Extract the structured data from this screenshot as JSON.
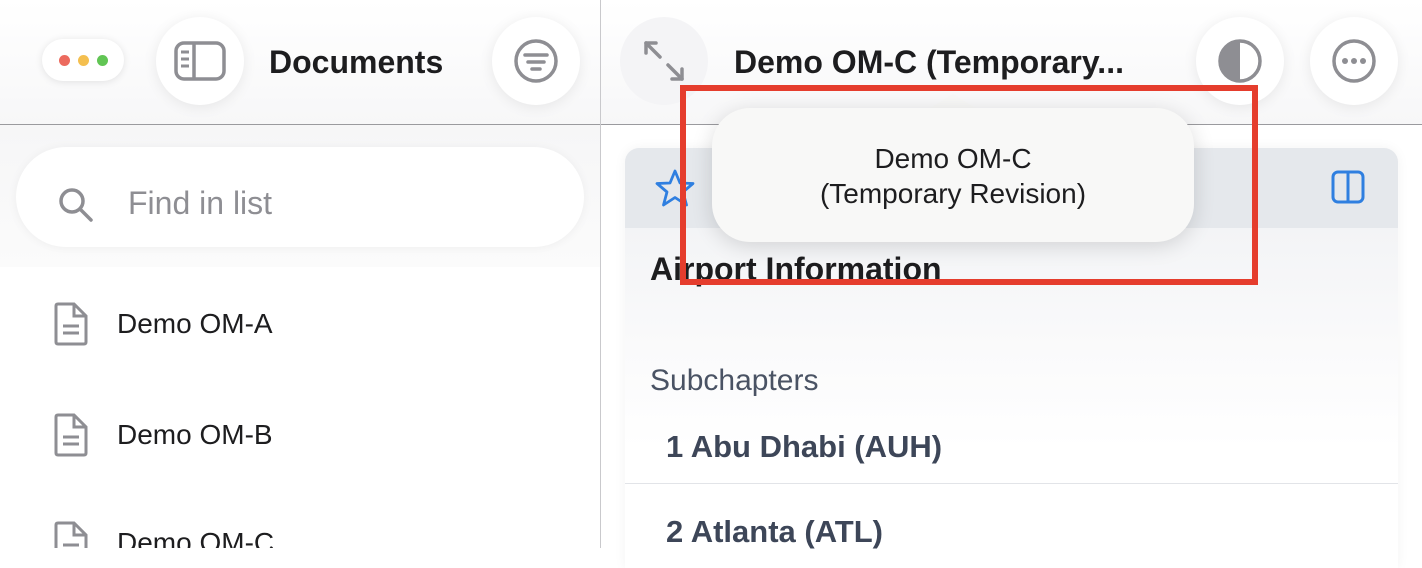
{
  "window": {
    "traffic_lights": [
      "close",
      "minimize",
      "zoom"
    ]
  },
  "header": {
    "sidebar_title": "Documents",
    "document_title": "Demo OM-C (Temporary...",
    "icons": {
      "sidebar_toggle": "sidebar-toggle-icon",
      "filter": "filter-icon",
      "expand": "expand-arrows-icon",
      "appearance": "contrast-icon",
      "more": "ellipsis-icon"
    }
  },
  "sidebar": {
    "search": {
      "placeholder": "Find in list"
    },
    "documents": [
      {
        "label": "Demo OM-A"
      },
      {
        "label": "Demo OM-B"
      },
      {
        "label": "Demo OM-C"
      }
    ]
  },
  "panel": {
    "title": "Airport Information",
    "subchapters_label": "Subchapters",
    "subchapters": [
      {
        "label": "1 Abu Dhabi (AUH)"
      },
      {
        "label": "2 Atlanta (ATL)"
      }
    ]
  },
  "tooltip": {
    "line1": "Demo OM-C",
    "line2": "(Temporary Revision)"
  },
  "colors": {
    "accent": "#2f7fe0",
    "highlight_border": "#e53d2d",
    "panel_header": "#e5e8ec"
  }
}
